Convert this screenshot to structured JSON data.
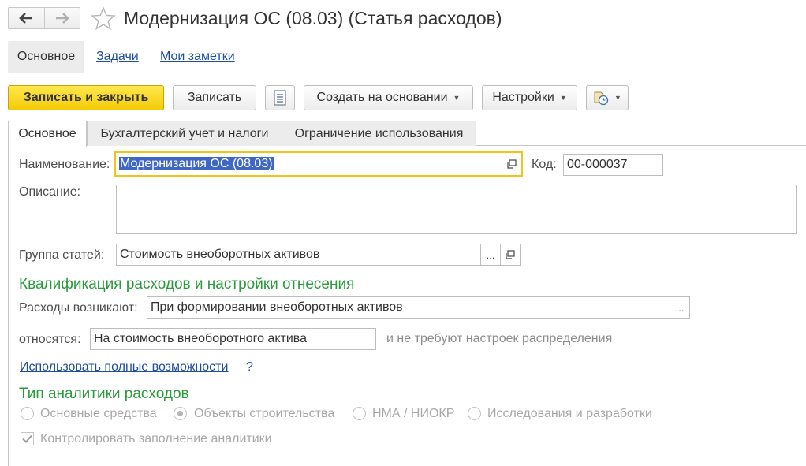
{
  "header": {
    "title": "Модернизация ОС (08.03) (Статья расходов)"
  },
  "sections": {
    "main": "Основное",
    "tasks": "Задачи",
    "notes": "Мои заметки"
  },
  "toolbar": {
    "save_close": "Записать и закрыть",
    "save": "Записать",
    "create_based": "Создать на основании",
    "settings": "Настройки"
  },
  "tabs": [
    "Основное",
    "Бухгалтерский учет и налоги",
    "Ограничение использования"
  ],
  "form": {
    "name_label": "Наименование:",
    "name_value": "Модернизация ОС (08.03)",
    "code_label": "Код:",
    "code_value": "00-000037",
    "description_label": "Описание:",
    "description_value": "",
    "group_label": "Группа статей:",
    "group_value": "Стоимость внеоборотных активов",
    "qualification_title": "Квалификация расходов и настройки отнесения",
    "arise_label": "Расходы возникают:",
    "arise_value": "При формировании внеоборотных активов",
    "relate_label": "относятся:",
    "relate_value": "На стоимость внеоборотного актива",
    "relate_note": "и не требуют настроек распределения",
    "full_link": "Использовать полные возможности",
    "help": "?",
    "analytics_title": "Тип аналитики расходов",
    "analytics_options": [
      "Основные средства",
      "Объекты строительства",
      "НМА / НИОКР",
      "Исследования и разработки"
    ],
    "analytics_selected": 1,
    "control_label": "Контролировать заполнение аналитики",
    "control_checked": true
  }
}
